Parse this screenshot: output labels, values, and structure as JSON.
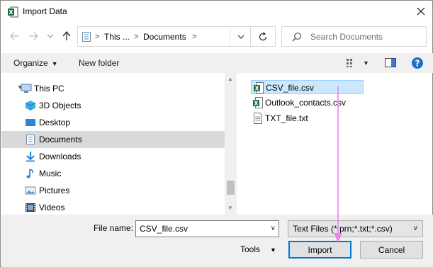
{
  "window": {
    "title": "Import Data"
  },
  "address": {
    "segments": [
      "This ...",
      "Documents"
    ]
  },
  "search": {
    "placeholder": "Search Documents"
  },
  "toolbar": {
    "organize_label": "Organize",
    "new_folder_label": "New folder"
  },
  "nav": {
    "items": [
      {
        "label": "This PC",
        "icon": "computer-icon"
      },
      {
        "label": "3D Objects",
        "icon": "cube-icon"
      },
      {
        "label": "Desktop",
        "icon": "desktop-icon"
      },
      {
        "label": "Documents",
        "icon": "documents-icon"
      },
      {
        "label": "Downloads",
        "icon": "download-icon"
      },
      {
        "label": "Music",
        "icon": "music-icon"
      },
      {
        "label": "Pictures",
        "icon": "pictures-icon"
      },
      {
        "label": "Videos",
        "icon": "videos-icon"
      }
    ],
    "selected": "Documents"
  },
  "files": [
    {
      "name": "CSV_file.csv",
      "icon": "excel-csv-icon"
    },
    {
      "name": "Outlook_contacts.csv",
      "icon": "excel-csv-icon"
    },
    {
      "name": "TXT_file.txt",
      "icon": "text-file-icon"
    }
  ],
  "bottom": {
    "file_name_label": "File name:",
    "file_name_value": "CSV_file.csv",
    "filter_value": "Text Files (*.prn;*.txt;*.csv)",
    "tools_label": "Tools",
    "import_label": "Import",
    "cancel_label": "Cancel"
  },
  "colors": {
    "selection": "#cce8ff",
    "accent": "#0078d7",
    "annotation": "#ee82ee",
    "excel_green": "#1d6f42"
  }
}
